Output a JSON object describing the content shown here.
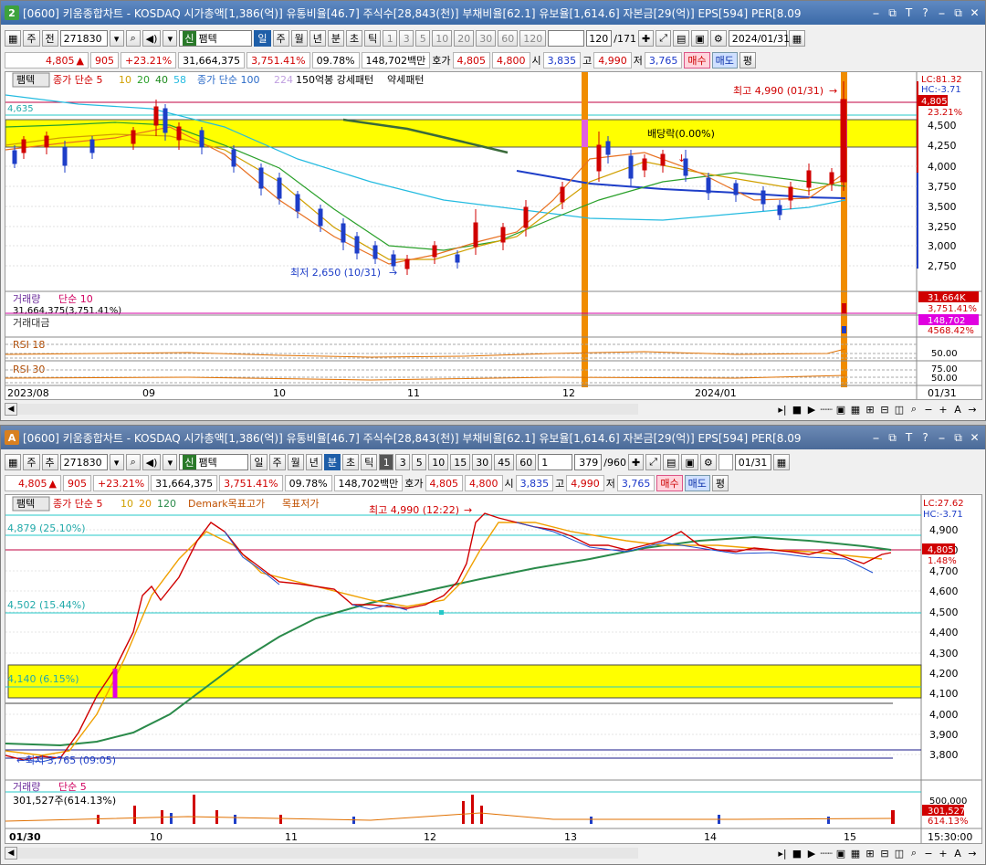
{
  "w1": {
    "num": "2",
    "title": "[0600] 키움종합차트 - KOSDAQ 시가총액[1,386(억)] 유통비율[46.7] 주식수[28,843(천)] 부채비율[62.1] 유보율[1,614.6] 자본금[29(억)] EPS[594] PER[8.09",
    "wbtns": [
      "⎯",
      "⧉",
      "T",
      "?",
      "⎯",
      "⧉",
      "✕"
    ],
    "tb": {
      "ju": "주",
      "jeon": "전",
      "code": "271830",
      "name": "팸텍",
      "periods": [
        "일",
        "주",
        "월",
        "년",
        "분",
        "초",
        "틱"
      ],
      "nums": [
        "1",
        "3",
        "5",
        "10",
        "20",
        "30",
        "60",
        "120"
      ],
      "cnt": "120",
      "tot": "/171",
      "date": "2024/01/31"
    },
    "q": {
      "price": "4,805",
      "ch": "905",
      "pct": "+23.21%",
      "vol": "31,664,375",
      "vr": "3,751.41%",
      "tr": "09.78%",
      "amt": "148,702백만",
      "hoga": "호가",
      "h1": "4,805",
      "h2": "4,800",
      "si": "시",
      "open": "3,835",
      "go": "고",
      "high": "4,990",
      "jeo": "저",
      "low": "3,765",
      "buy": "매수",
      "sell": "매도",
      "pyeong": "평"
    },
    "legend": {
      "name": "팸텍",
      "ma": "종가 단순 5",
      "p10": "10",
      "p20": "20",
      "p40": "40",
      "p58": "58",
      "ma2": "종가 단순 100",
      "p224": "224",
      "pat": "150억봉 강세패턴",
      "pat2": "약세패턴"
    },
    "ann": {
      "high": "최고 4,990 (01/31)",
      "low": "최저 2,650 (10/31)",
      "div": "배당락(0.00%)",
      "l4635": "4,635"
    },
    "yaxis": [
      "4,500",
      "4,250",
      "4,000",
      "3,750",
      "3,500",
      "3,250",
      "3,000",
      "2,750"
    ],
    "rside": {
      "lc": "LC:81.32",
      "hc": "HC:-3.71",
      "price": "4,805",
      "pct": "23.21%"
    },
    "vol": {
      "label": "거래량",
      "ma": "단순 10",
      "val": "31,664,375(3,751.41%)",
      "box": "31,664K",
      "boxp": "3,751.41%"
    },
    "amt": {
      "label": "거래대금",
      "box": "148,702",
      "boxp": "4568.42%"
    },
    "rsi1": {
      "label": "RSI 18",
      "v": "50.00"
    },
    "rsi2": {
      "label": "RSI 30",
      "v75": "75.00",
      "v50": "50.00"
    },
    "xaxis": [
      "2023/08",
      "09",
      "10",
      "11",
      "12",
      "2024/01",
      "01/31"
    ]
  },
  "w2": {
    "num": "A",
    "title": "[0600] 키움종합차트 - KOSDAQ 시가총액[1,386(억)] 유통비율[46.7] 주식수[28,843(천)] 부채비율[62.1] 유보율[1,614.6] 자본금[29(억)] EPS[594] PER[8.09",
    "tb": {
      "ju": "주",
      "chu": "추",
      "code": "271830",
      "name": "팸텍",
      "periods": [
        "일",
        "주",
        "월",
        "년",
        "분",
        "초",
        "틱"
      ],
      "nums": [
        "1",
        "3",
        "5",
        "10",
        "15",
        "30",
        "45",
        "60"
      ],
      "unit": "1",
      "cnt": "379",
      "tot": "/960",
      "date": "01/31"
    },
    "legend": {
      "name": "팸텍",
      "ma": "종가 단순 5",
      "p10": "10",
      "p20": "20",
      "p120": "120",
      "dm": "Demark목표고가",
      "dm2": "목표저가"
    },
    "ann": {
      "high": "최고 4,990 (12:22)",
      "low": "최저 3,765 (09:05)",
      "l1": "4,879 (25.10%)",
      "l2": "4,502 (15.44%)",
      "l3": "4,140 (6.15%)"
    },
    "yaxis": [
      "4,900",
      "4,800",
      "4,700",
      "4,600",
      "4,500",
      "4,400",
      "4,300",
      "4,200",
      "4,100",
      "4,000",
      "3,900",
      "3,800"
    ],
    "rside": {
      "lc": "LC:27.62",
      "hc": "HC:-3.71",
      "price": "4,805",
      "pct": "1.48%"
    },
    "vol": {
      "label": "거래량",
      "ma": "단순 5",
      "val": "301,527주(614.13%)",
      "y500": "500,000",
      "box": "301,527",
      "boxp": "614.13%"
    },
    "xaxis": [
      "01/30",
      "10",
      "11",
      "12",
      "13",
      "14",
      "15",
      "15:30:00"
    ]
  }
}
